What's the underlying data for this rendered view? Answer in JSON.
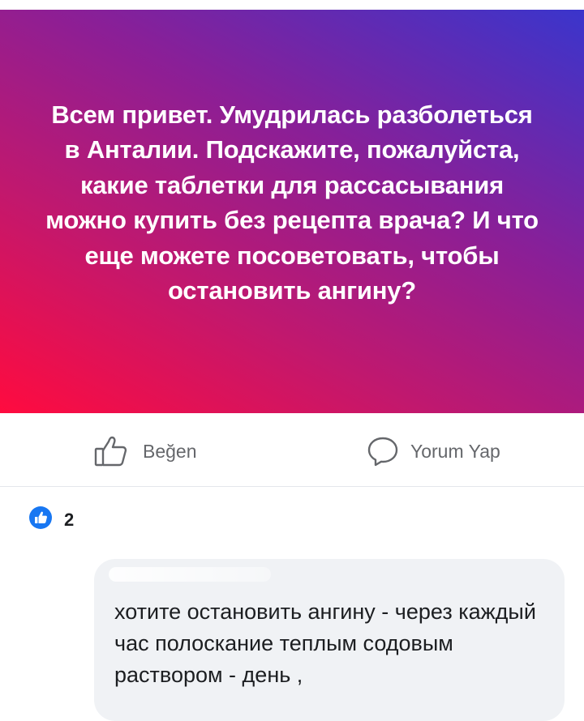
{
  "post": {
    "text": "Всем привет. Умудрилась разболеться в Анталии. Подскажите, пожалуйста, какие таблетки для рассасывания можно купить без рецепта врача? И что еще можете посоветовать, чтобы остановить ангину?"
  },
  "actions": {
    "like_label": "Beğen",
    "comment_label": "Yorum Yap"
  },
  "reactions": {
    "count": "2"
  },
  "comment": {
    "text": "хотите остановить ангину - через каждый час полоскание теплым содовым раствором - день ,"
  },
  "icons": {
    "like": "thumbs-up-outline-icon",
    "comment": "speech-bubble-outline-icon",
    "reaction": "like-reaction-icon"
  },
  "colors": {
    "gradient_start": "#ff0b3f",
    "gradient_end": "#3a35cc",
    "action_text": "#65676b",
    "like_blue": "#1877f2",
    "comment_bg": "#f0f2f5"
  }
}
